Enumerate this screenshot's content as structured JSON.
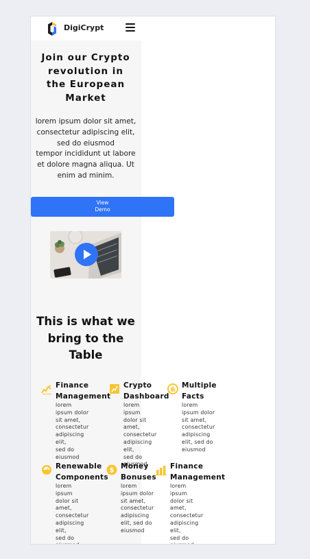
{
  "header": {
    "brand": "DigiCrypt"
  },
  "hero": {
    "title_lines": [
      "Join our Crypto",
      "revolution in",
      "the European",
      "Market"
    ],
    "text_lines": [
      "lorem ipsum dolor sit amet,",
      "consectetur adipiscing elit,",
      "sed do eiusmod",
      "tempor incididunt ut labore",
      "et dolore magna aliqua. Ut",
      "enim ad minim."
    ],
    "button_lines": [
      "View",
      "Demo"
    ]
  },
  "section": {
    "title_lines": [
      "This is what we",
      "bring to the",
      "Table"
    ]
  },
  "features": [
    {
      "icon": "chart-hand-icon",
      "title_lines": [
        "Finance",
        "Management"
      ],
      "text_lines": [
        "lorem ipsum dolor",
        "sit amet,",
        "consectetur",
        "adipiscing elit,",
        "sed do eiusmod"
      ]
    },
    {
      "icon": "dashboard-icon",
      "title_lines": [
        "Crypto",
        "Dashboard"
      ],
      "text_lines": [
        "lorem ipsum",
        "dolor sit amet,",
        "consectetur",
        "adipiscing elit,",
        "sed do",
        "eiusmod"
      ]
    },
    {
      "icon": "gauge-icon",
      "title_lines": [
        "Multiple",
        "Facts"
      ],
      "text_lines": [
        "lorem",
        "ipsum dolor",
        "sit amet,",
        "consectetur",
        "adipiscing",
        "elit, sed do",
        "eiusmod"
      ]
    },
    {
      "icon": "speedometer-icon",
      "title_lines": [
        "Renewable",
        "Components"
      ],
      "text_lines": [
        "lorem ipsum",
        "dolor sit amet,",
        "consectetur",
        "adipiscing elit,",
        "sed do eiusmod"
      ]
    },
    {
      "icon": "dollar-coin-icon",
      "title_lines": [
        "Money",
        "Bonuses"
      ],
      "text_lines": [
        "lorem",
        "ipsum dolor",
        "sit amet,",
        "consectetur",
        "adipiscing",
        "elit, sed do",
        "eiusmod"
      ]
    },
    {
      "icon": "bar-chart-icon",
      "title_lines": [
        "Finance",
        "Management"
      ],
      "text_lines": [
        "lorem ipsum",
        "dolor sit amet,",
        "consectetur",
        "adipiscing elit,",
        "sed do eiusmod"
      ]
    }
  ],
  "colors": {
    "accent": "#2f73f6",
    "icon_yellow": "#f7c531",
    "column_bg": "#f6f6f7"
  }
}
